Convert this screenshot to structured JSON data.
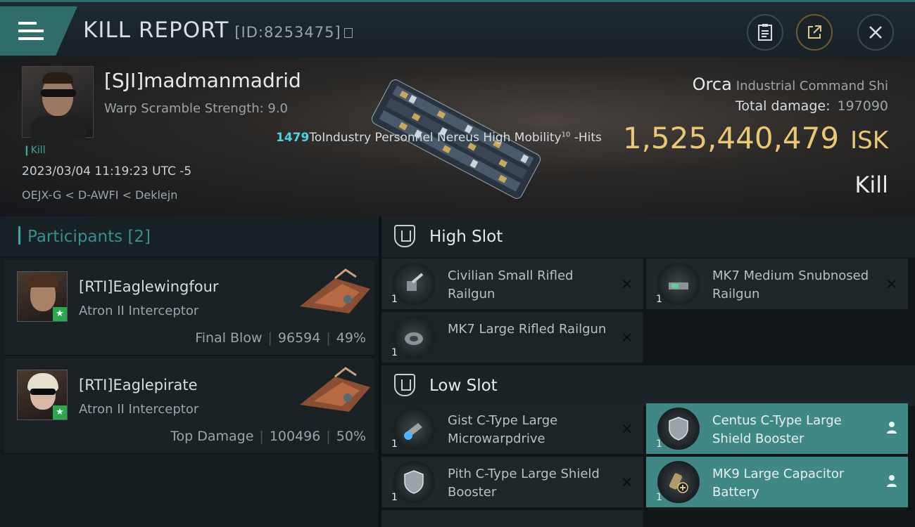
{
  "titlebar": {
    "title": "KILL REPORT",
    "id": "[ID:8253475]",
    "report_icon": "clipboard-icon",
    "share_icon": "share-icon",
    "close_icon": "close-icon"
  },
  "victim": {
    "name": "[SJI]madmanmadrid",
    "warp": "Warp Scramble Strength: 9.0",
    "tag": "Kill",
    "datetime": "2023/03/04 11:19:23 UTC -5",
    "location": "OEJX-G < D-AWFI < Deklejn",
    "ship": "Orca",
    "ship_class": "Industrial Command Shi",
    "total_damage_label": "Total damage:",
    "total_damage": "197090",
    "isk_value": "1,525,440,479",
    "isk_unit": "ISK",
    "result": "Kill"
  },
  "ticker": {
    "num": "1479",
    "text": "ToIndustry Personnel Nereus High Mobility",
    "sup": "10",
    "suffix": " -Hits"
  },
  "participants": {
    "header": "Participants [2]",
    "list": [
      {
        "name": "[RTI]Eaglewingfour",
        "ship": "Atron II Interceptor",
        "role": "Final Blow",
        "damage": "96594",
        "pct": "49%"
      },
      {
        "name": "[RTI]Eaglepirate",
        "ship": "Atron II Interceptor",
        "role": "Top Damage",
        "damage": "100496",
        "pct": "50%"
      }
    ]
  },
  "slots": {
    "high_label": "High Slot",
    "low_label": "Low Slot",
    "high": [
      {
        "name": "Civilian Small Rifled Railgun",
        "qty": "1",
        "status": "×"
      },
      {
        "name": "MK7 Medium Snubnosed Railgun",
        "qty": "1",
        "status": "×"
      },
      {
        "name": "MK7 Large Rifled Railgun",
        "qty": "1",
        "status": "×"
      }
    ],
    "low": [
      {
        "name": "Gist C-Type Large Microwarpdrive",
        "qty": "1",
        "status": "×"
      },
      {
        "name": "Centus C-Type Large Shield Booster",
        "qty": "1",
        "status": "person-icon"
      },
      {
        "name": "Pith C-Type Large Shield Booster",
        "qty": "1",
        "status": "×"
      },
      {
        "name": "MK9 Large Capacitor Battery",
        "qty": "1",
        "status": "person-icon"
      }
    ]
  },
  "colors": {
    "accent": "#3aa7a2",
    "isk": "#e8c874",
    "dropped": "#3f8885"
  }
}
